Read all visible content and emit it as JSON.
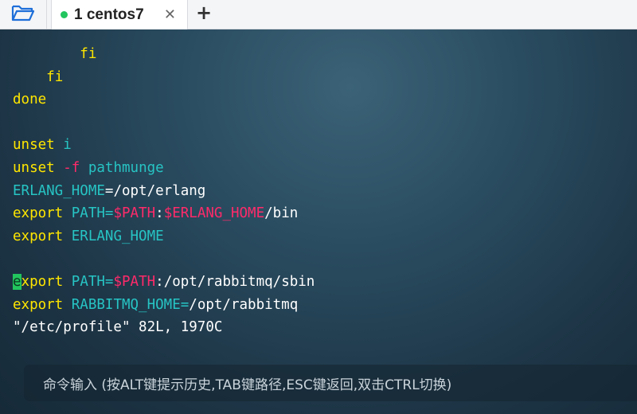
{
  "tabbar": {
    "folder_icon": "folder-open-icon",
    "tab": {
      "label": "1 centos7",
      "status_color": "#22c55e",
      "close_label": "✕"
    },
    "add_label": "+"
  },
  "terminal": {
    "lines": [
      [
        [
          "        ",
          "wh"
        ],
        [
          "fi",
          "kw"
        ]
      ],
      [
        [
          "    ",
          "wh"
        ],
        [
          "fi",
          "kw"
        ]
      ],
      [
        [
          "done",
          "kw"
        ]
      ],
      [],
      [
        [
          "unset",
          "kw"
        ],
        [
          " ",
          "wh"
        ],
        [
          "i",
          "cy"
        ]
      ],
      [
        [
          "unset",
          "kw"
        ],
        [
          " ",
          "wh"
        ],
        [
          "-f",
          "rd"
        ],
        [
          " ",
          "wh"
        ],
        [
          "pathmunge",
          "cy"
        ]
      ],
      [
        [
          "ERLANG_HOME",
          "cy"
        ],
        [
          "=/opt/erlang",
          "wh"
        ]
      ],
      [
        [
          "export",
          "kw"
        ],
        [
          " ",
          "wh"
        ],
        [
          "PATH=",
          "cy"
        ],
        [
          "$PATH",
          "rd"
        ],
        [
          ":",
          "wh"
        ],
        [
          "$ERLANG_HOME",
          "rd"
        ],
        [
          "/bin",
          "wh"
        ]
      ],
      [
        [
          "export",
          "kw"
        ],
        [
          " ",
          "wh"
        ],
        [
          "ERLANG_HOME",
          "cy"
        ]
      ],
      [],
      [
        [
          "e",
          "kw"
        ],
        [
          "xport",
          "kw"
        ],
        [
          " ",
          "wh"
        ],
        [
          "PATH=",
          "cy"
        ],
        [
          "$PATH",
          "rd"
        ],
        [
          ":/opt/rabbitmq/sbin",
          "wh"
        ]
      ],
      [
        [
          "export",
          "kw"
        ],
        [
          " ",
          "wh"
        ],
        [
          "RABBITMQ_HOME=",
          "cy"
        ],
        [
          "/opt/rabbitmq",
          "wh"
        ]
      ],
      [
        [
          "\"/etc/profile\" 82L, 1970C",
          "wh"
        ]
      ]
    ],
    "cursor_line": 10,
    "colors": {
      "keyword": "#ffe600",
      "variable": "#27c4c4",
      "special": "#ff2a6a",
      "cursor": "#22c55e"
    }
  },
  "command_bar": {
    "hint": "命令输入 (按ALT键提示历史,TAB键路径,ESC键返回,双击CTRL切换)"
  }
}
